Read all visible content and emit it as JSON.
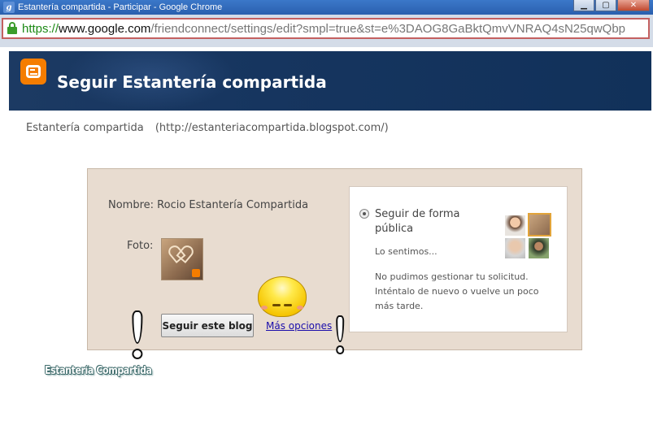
{
  "window": {
    "app_icon": "g",
    "title": "Estantería compartida - Participar - Google Chrome",
    "buttons": {
      "minimize": "▁",
      "maximize": "▢",
      "close": "✕"
    }
  },
  "address_bar": {
    "protocol": "https://",
    "host": "www.google.com",
    "path": "/friendconnect/settings/edit?smpl=true&st=e%3DAOG8GaBktQmvVNRAQ4sN25qwQbp"
  },
  "header": {
    "logo": "blogger-logo",
    "title": "Seguir Estantería compartida"
  },
  "blog": {
    "name": "Estantería compartida",
    "url": "(http://estanteriacompartida.blogspot.com/)"
  },
  "form": {
    "name_label": "Nombre:",
    "name_value": "Rocio Estantería Compartida",
    "photo_label": "Foto:",
    "follow_button": "Seguir este blog",
    "more_options": "Más opciones"
  },
  "follow_options": {
    "public_label": "Seguir de forma pública",
    "sorry": "Lo sentimos...",
    "error": "No pudimos gestionar tu solicitud. Inténtalo de nuevo o vuelve un poco más tarde."
  },
  "watermark": "Estantería Compartida",
  "colors": {
    "header_bg": "#16355f",
    "panel_bg": "#e8dcd0",
    "link": "#1a0dab",
    "blogger_orange": "#f57d00",
    "url_green": "#1d8a16"
  }
}
